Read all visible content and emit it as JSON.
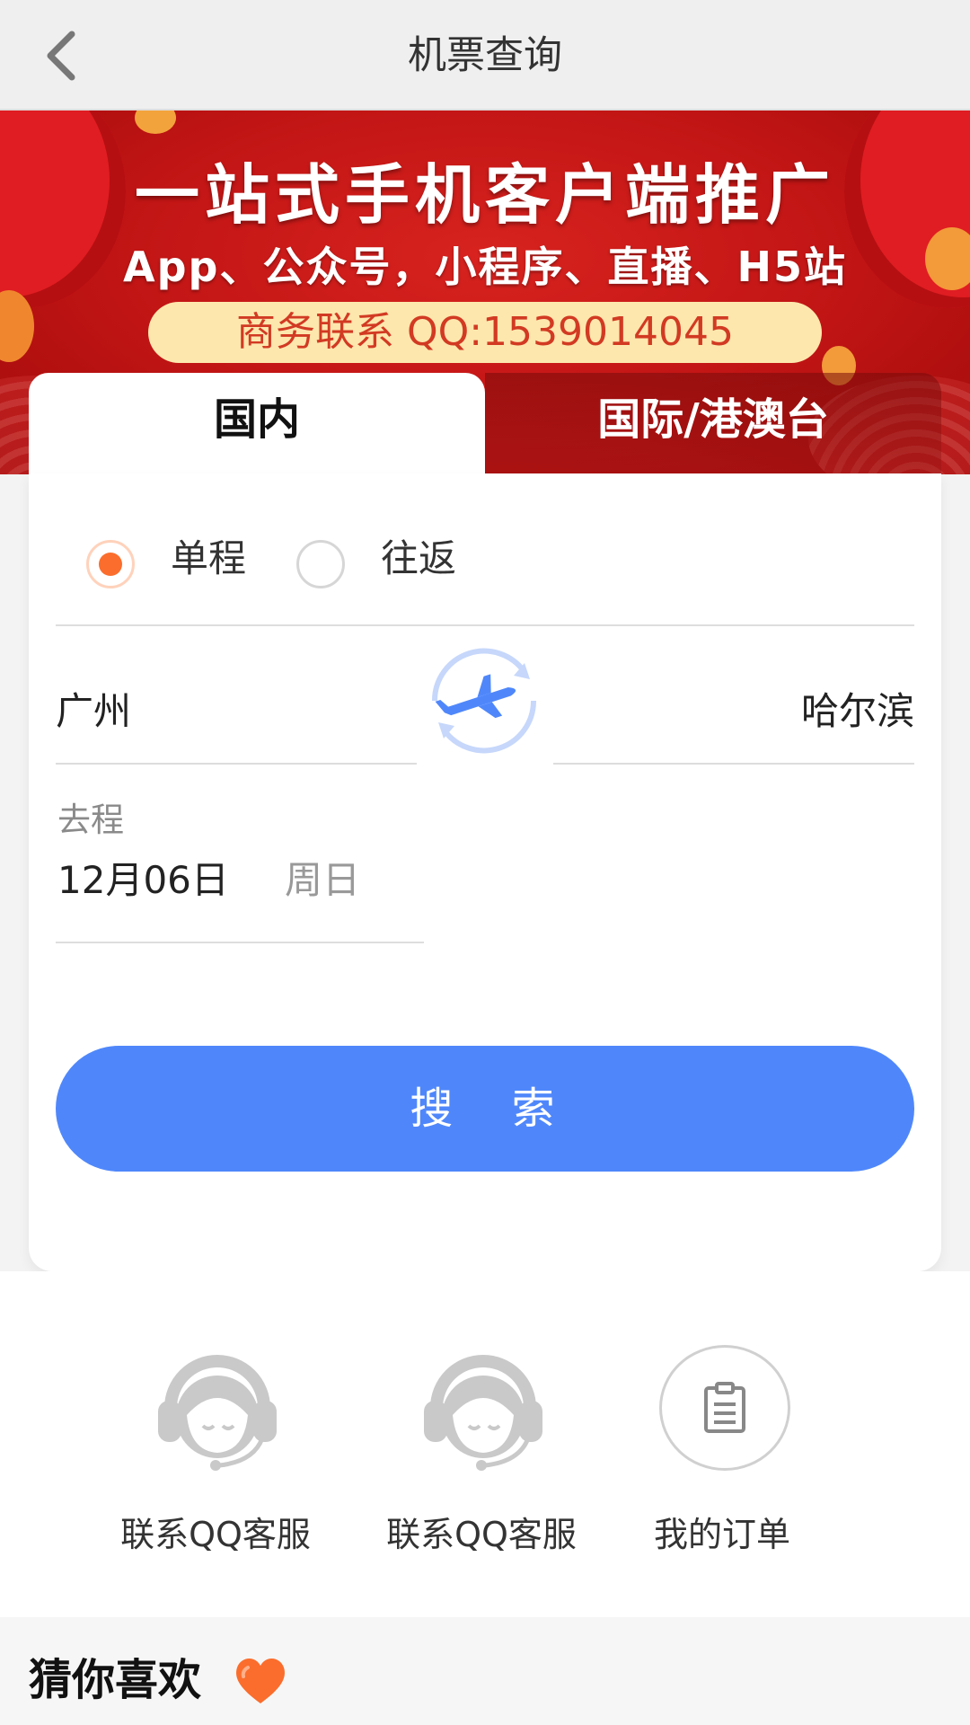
{
  "header": {
    "title": "机票查询",
    "back_icon": "chevron-left-icon"
  },
  "banner": {
    "line1": "一站式手机客户端推广",
    "line2": "App、公众号，小程序、直播、H5站",
    "contact": "商务联系 QQ:1539014045"
  },
  "tabs": [
    {
      "label": "国内",
      "active": true
    },
    {
      "label": "国际/港澳台",
      "active": false
    }
  ],
  "trip_type": {
    "options": [
      {
        "label": "单程",
        "selected": true
      },
      {
        "label": "往返",
        "selected": false
      }
    ]
  },
  "route": {
    "from": "广州",
    "to": "哈尔滨",
    "swap_icon": "plane-swap-icon"
  },
  "departure": {
    "label": "去程",
    "date": "12月06日",
    "weekday": "周日"
  },
  "search": {
    "label": "搜 索"
  },
  "quick_links": [
    {
      "label": "联系QQ客服",
      "icon": "customer-service-icon"
    },
    {
      "label": "联系QQ客服",
      "icon": "customer-service-icon"
    },
    {
      "label": "我的订单",
      "icon": "clipboard-icon"
    }
  ],
  "recommend": {
    "title": "猜你喜欢",
    "icon": "heart-icon"
  },
  "colors": {
    "primary": "#4f87fb",
    "radio_active": "#fb6d2c",
    "banner_red": "#c01414",
    "contact_bg": "#fde7ad"
  }
}
